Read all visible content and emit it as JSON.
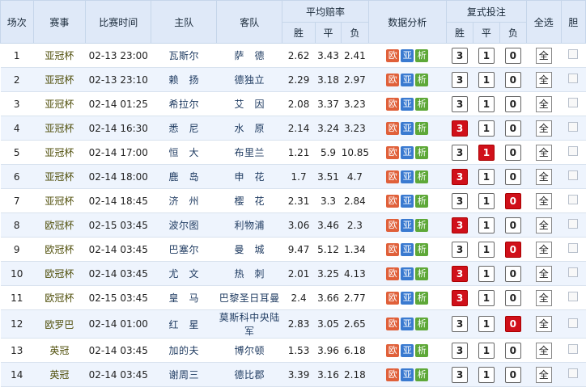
{
  "header": {
    "no": "场次",
    "comp": "赛事",
    "time": "比赛时间",
    "home": "主队",
    "away": "客队",
    "avg_odds": "平均赔率",
    "analysis": "数据分析",
    "multi": "复式投注",
    "all": "全选",
    "dan": "胆",
    "sub_w": "胜",
    "sub_d": "平",
    "sub_l": "负",
    "sub_w2": "胜",
    "sub_d2": "平",
    "sub_l2": "负"
  },
  "labels": {
    "ou": "欧",
    "ya": "亚",
    "xi": "析",
    "all_btn": "全"
  },
  "colors": {
    "pick_active": "#d0101a",
    "header_bg": "#dfe9f8",
    "row_alt": "#eef4fd"
  },
  "rows": [
    {
      "no": "1",
      "comp": "亚冠杯",
      "time": "02-13 23:00",
      "home": "瓦斯尔",
      "away": "萨　德",
      "w": "2.62",
      "d": "3.43",
      "l": "2.41",
      "pw": "3",
      "pd": "1",
      "pl": "0",
      "active": ""
    },
    {
      "no": "2",
      "comp": "亚冠杯",
      "time": "02-13 23:10",
      "home": "赖　扬",
      "away": "德独立",
      "w": "2.29",
      "d": "3.18",
      "l": "2.97",
      "pw": "3",
      "pd": "1",
      "pl": "0",
      "active": ""
    },
    {
      "no": "3",
      "comp": "亚冠杯",
      "time": "02-14 01:25",
      "home": "希拉尔",
      "away": "艾　因",
      "w": "2.08",
      "d": "3.37",
      "l": "3.23",
      "pw": "3",
      "pd": "1",
      "pl": "0",
      "active": ""
    },
    {
      "no": "4",
      "comp": "亚冠杯",
      "time": "02-14 16:30",
      "home": "悉　尼",
      "away": "水　原",
      "w": "2.14",
      "d": "3.24",
      "l": "3.23",
      "pw": "3",
      "pd": "1",
      "pl": "0",
      "active": "w"
    },
    {
      "no": "5",
      "comp": "亚冠杯",
      "time": "02-14 17:00",
      "home": "恒　大",
      "away": "布里兰",
      "w": "1.21",
      "d": "5.9",
      "l": "10.85",
      "pw": "3",
      "pd": "1",
      "pl": "0",
      "active": "d"
    },
    {
      "no": "6",
      "comp": "亚冠杯",
      "time": "02-14 18:00",
      "home": "鹿　岛",
      "away": "申　花",
      "w": "1.7",
      "d": "3.51",
      "l": "4.7",
      "pw": "3",
      "pd": "1",
      "pl": "0",
      "active": "w"
    },
    {
      "no": "7",
      "comp": "亚冠杯",
      "time": "02-14 18:45",
      "home": "济　州",
      "away": "樱　花",
      "w": "2.31",
      "d": "3.3",
      "l": "2.84",
      "pw": "3",
      "pd": "1",
      "pl": "0",
      "active": "l"
    },
    {
      "no": "8",
      "comp": "欧冠杯",
      "time": "02-15 03:45",
      "home": "波尔图",
      "away": "利物浦",
      "w": "3.06",
      "d": "3.46",
      "l": "2.3",
      "pw": "3",
      "pd": "1",
      "pl": "0",
      "active": "w"
    },
    {
      "no": "9",
      "comp": "欧冠杯",
      "time": "02-14 03:45",
      "home": "巴塞尔",
      "away": "曼　城",
      "w": "9.47",
      "d": "5.12",
      "l": "1.34",
      "pw": "3",
      "pd": "1",
      "pl": "0",
      "active": "l"
    },
    {
      "no": "10",
      "comp": "欧冠杯",
      "time": "02-14 03:45",
      "home": "尤　文",
      "away": "热　刺",
      "w": "2.01",
      "d": "3.25",
      "l": "4.13",
      "pw": "3",
      "pd": "1",
      "pl": "0",
      "active": "w"
    },
    {
      "no": "11",
      "comp": "欧冠杯",
      "time": "02-15 03:45",
      "home": "皇　马",
      "away": "巴黎圣日耳曼",
      "w": "2.4",
      "d": "3.66",
      "l": "2.77",
      "pw": "3",
      "pd": "1",
      "pl": "0",
      "active": "w"
    },
    {
      "no": "12",
      "comp": "欧罗巴",
      "time": "02-14 01:00",
      "home": "红　星",
      "away": "莫斯科中央陆军",
      "w": "2.83",
      "d": "3.05",
      "l": "2.65",
      "pw": "3",
      "pd": "1",
      "pl": "0",
      "active": "l"
    },
    {
      "no": "13",
      "comp": "英冠",
      "time": "02-14 03:45",
      "home": "加的夫",
      "away": "博尔顿",
      "w": "1.53",
      "d": "3.96",
      "l": "6.18",
      "pw": "3",
      "pd": "1",
      "pl": "0",
      "active": ""
    },
    {
      "no": "14",
      "comp": "英冠",
      "time": "02-14 03:45",
      "home": "谢周三",
      "away": "德比郡",
      "w": "3.39",
      "d": "3.16",
      "l": "2.18",
      "pw": "3",
      "pd": "1",
      "pl": "0",
      "active": ""
    }
  ]
}
